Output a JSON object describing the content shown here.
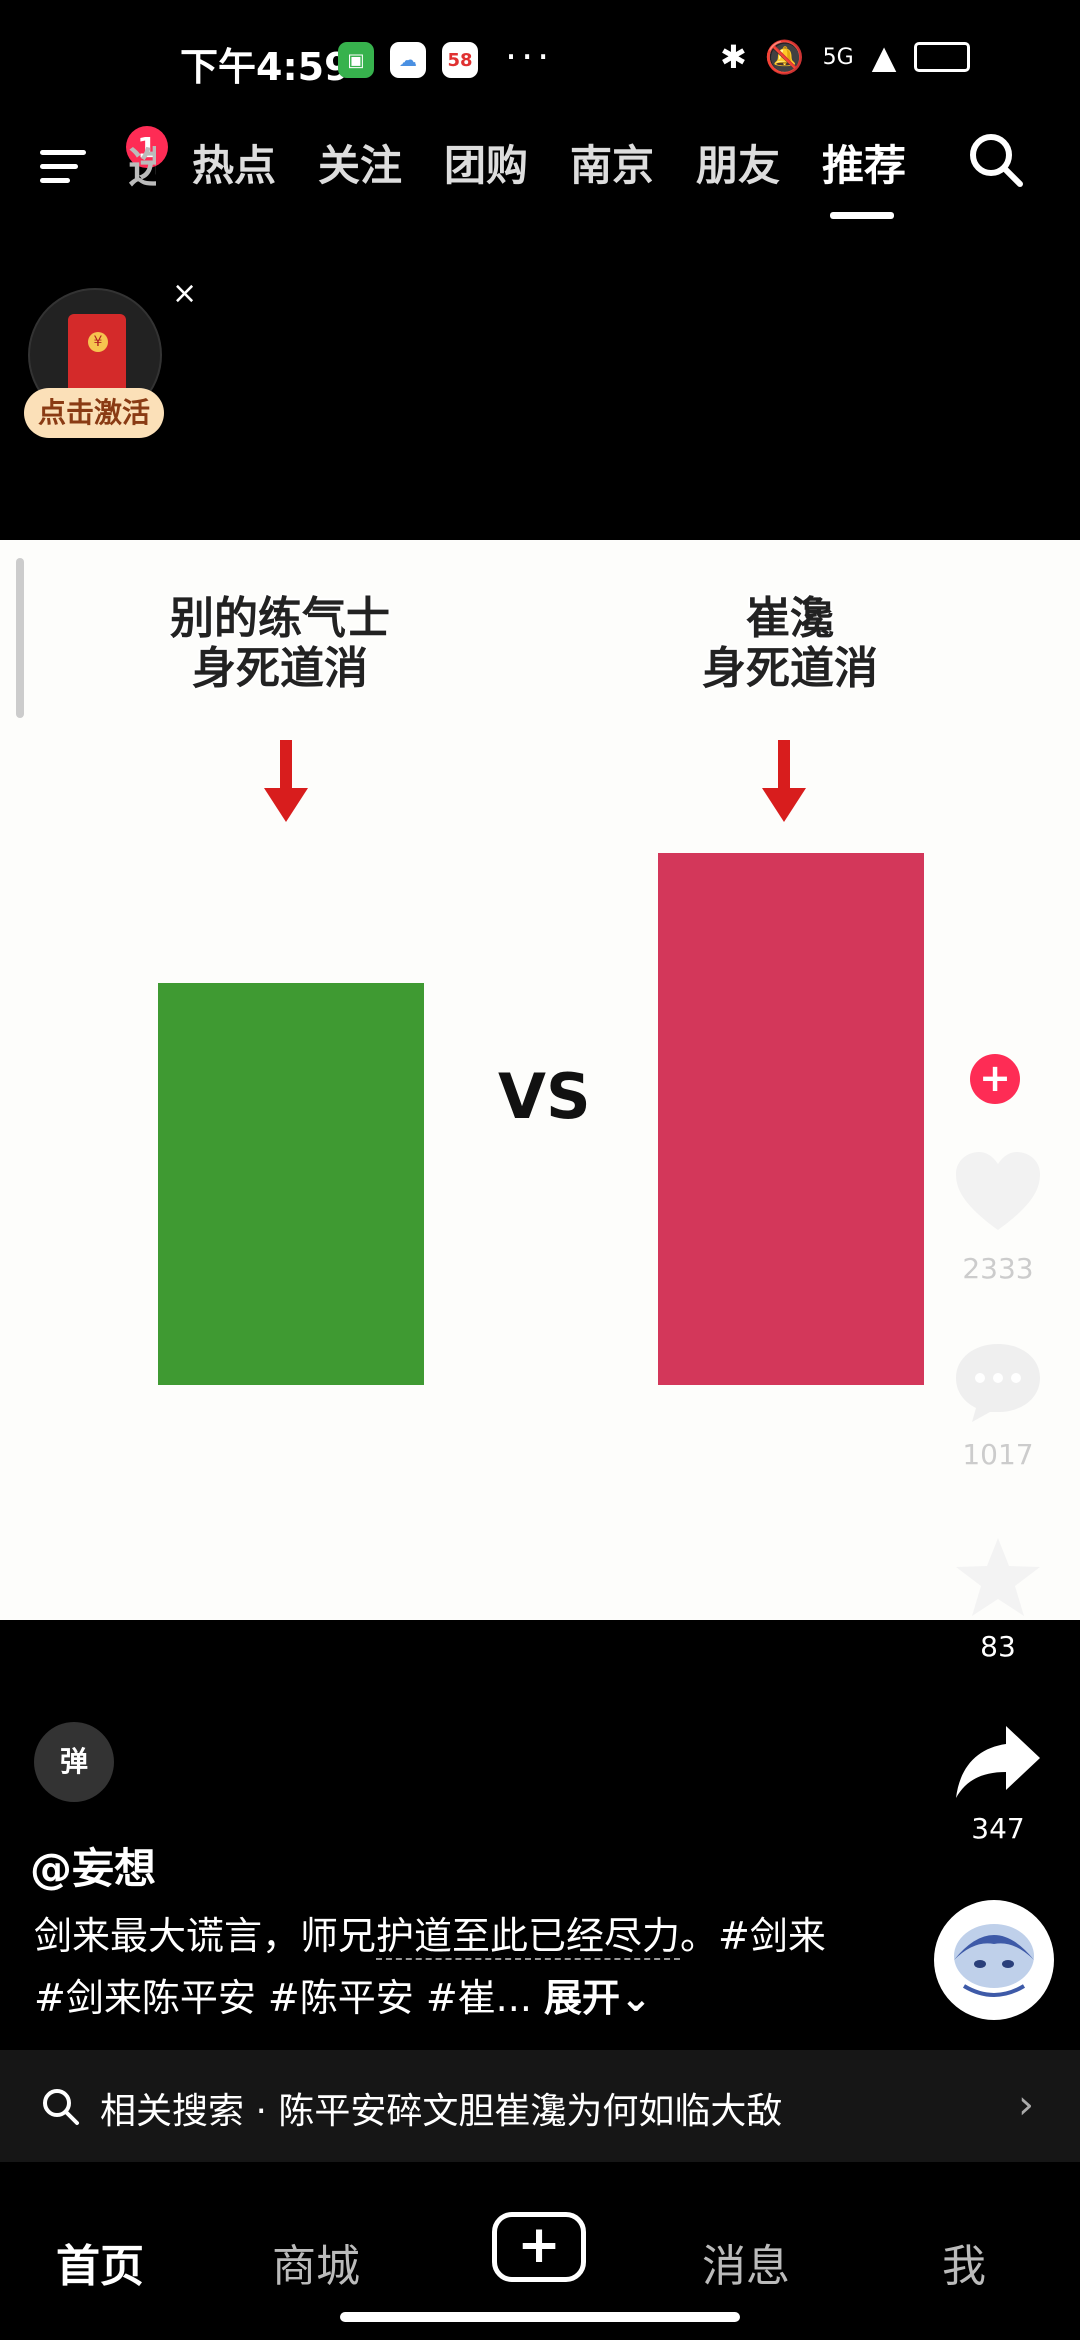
{
  "status_bar": {
    "time": "下午4:59",
    "app_icons": [
      {
        "name": "android-icon",
        "color": "#37b24d",
        "glyph": "▣"
      },
      {
        "name": "cloud-icon",
        "color": "#ffffff",
        "glyph": "☁"
      },
      {
        "name": "58-app-icon",
        "color": "#e03131",
        "glyph": "58"
      }
    ],
    "more_dots": "···",
    "network": "5G"
  },
  "top_nav": {
    "menu_badge": "1",
    "partial_tab": "选",
    "tabs": [
      {
        "label": "热点",
        "active": false
      },
      {
        "label": "关注",
        "active": false
      },
      {
        "label": "团购",
        "active": false
      },
      {
        "label": "南京",
        "active": false
      },
      {
        "label": "朋友",
        "active": false
      },
      {
        "label": "推荐",
        "active": true
      }
    ]
  },
  "packet_widget": {
    "label": "点击激活",
    "close": "×"
  },
  "video": {
    "caption_left": [
      "别的练气士",
      "身死道消"
    ],
    "caption_right": [
      "崔瀺",
      "身死道消"
    ],
    "vs": "VS",
    "colors": {
      "left_bar": "#3f9a32",
      "right_bar": "#d3375a",
      "arrow": "#d81d1d"
    }
  },
  "actions": {
    "follow_symbol": "+",
    "like_count": "2333",
    "comment_count": "1017",
    "favorite_count": "83",
    "share_count": "347"
  },
  "info": {
    "danmaku_label": "弹",
    "username": "@妄想",
    "description_prefix": "剑来最大谎言，师兄",
    "description_linked": "护道至此已经尽力",
    "description_suffix": "。#剑来 #剑来陈平安 #陈平安 #崔...",
    "expand_label": "展开⌄"
  },
  "related_search": {
    "text": "相关搜索 · 陈平安碎文胆崔瀺为何如临大敌",
    "chevron": "›"
  },
  "bottom_nav": {
    "home": "首页",
    "mall": "商城",
    "add": "+",
    "messages": "消息",
    "me": "我"
  }
}
